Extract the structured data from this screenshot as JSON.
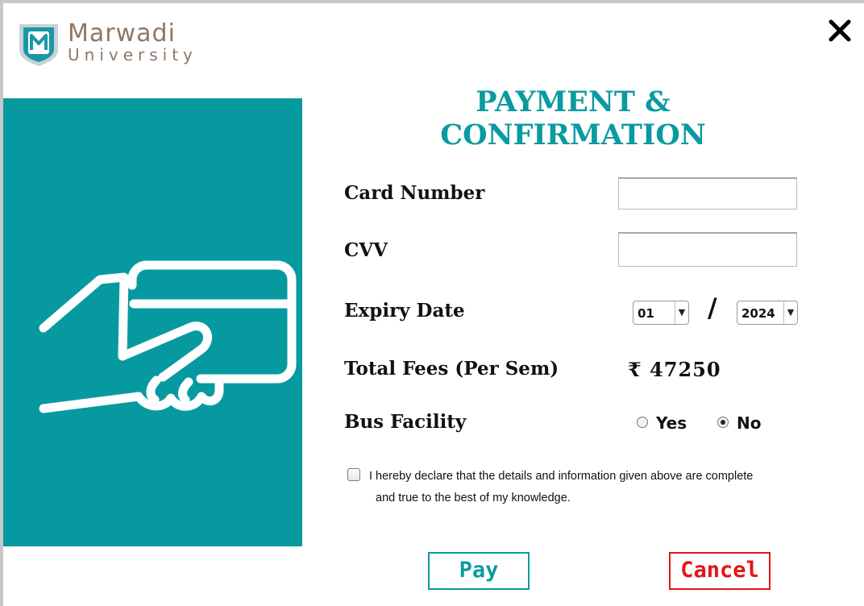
{
  "logo": {
    "name": "Marwadi",
    "subtitle": "University"
  },
  "heading": "PAYMENT & CONFIRMATION",
  "form": {
    "card_number_label": "Card Number",
    "card_number_value": "",
    "cvv_label": "CVV",
    "cvv_value": "",
    "expiry_label": "Expiry Date",
    "expiry_month": "01",
    "expiry_separator": "/",
    "expiry_year": "2024",
    "fees_label": "Total Fees (Per Sem)",
    "fees_value": "₹ 47250",
    "bus_label": "Bus Facility",
    "bus_options": [
      {
        "label": "Yes",
        "selected": false
      },
      {
        "label": "No",
        "selected": true
      }
    ],
    "declaration_line1": "I hereby declare that the details and information given above are complete",
    "declaration_line2": "and true to the best of my knowledge.",
    "declaration_checked": false
  },
  "buttons": {
    "pay": "Pay",
    "cancel": "Cancel"
  },
  "icons": {
    "close": "close-icon",
    "brand_shield": "marwadi-shield-logo",
    "hero": "hand-holding-card-icon"
  },
  "colors": {
    "accent": "#0a9aa1",
    "panel": "#069aa0",
    "danger": "#e01717",
    "brand_text": "#8e7768"
  }
}
